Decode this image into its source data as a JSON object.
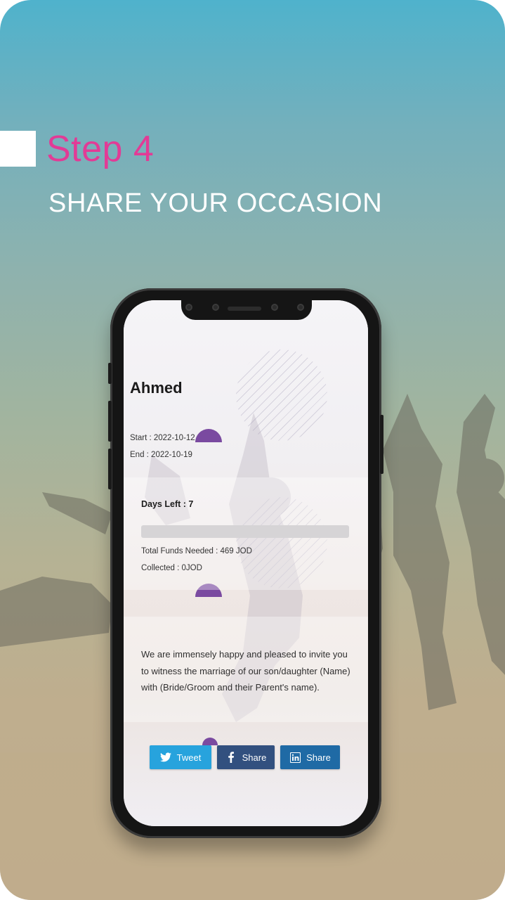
{
  "header": {
    "step_title": "Step 4",
    "step_subtitle": "SHARE YOUR OCCASION"
  },
  "occasion": {
    "name": "Ahmed",
    "start": "Start : 2022-10-12",
    "end": "End : 2022-10-19",
    "days_left": "Days Left : 7",
    "funds_needed": "Total Funds Needed : 469 JOD",
    "collected": "Collected : 0JOD",
    "progress_fraction": 0,
    "message": "We are immensely happy and pleased to invite you to witness the marriage of our son/daughter (Name) with (Bride/Groom and their Parent's name)."
  },
  "share_buttons": {
    "twitter": {
      "label": "Tweet",
      "icon": "twitter-icon",
      "color": "#27a3dd"
    },
    "facebook": {
      "label": "Share",
      "icon": "facebook-icon",
      "color": "#32507f"
    },
    "linkedin": {
      "label": "Share",
      "icon": "linkedin-icon",
      "color": "#1f6aa5"
    }
  },
  "colors": {
    "accent": "#e23b96",
    "purple": "#7a4aa0"
  }
}
